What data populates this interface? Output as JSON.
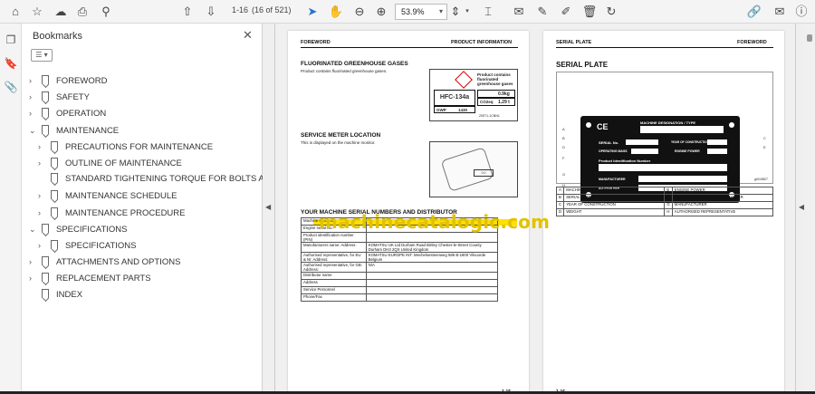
{
  "toolbar": {
    "page_current": "1-16",
    "page_count": "(16 of 521)",
    "zoom": "53.9%"
  },
  "bookmarks": {
    "title": "Bookmarks",
    "items": [
      {
        "label": "FOREWORD",
        "level": 0,
        "expand": true
      },
      {
        "label": "SAFETY",
        "level": 0,
        "expand": true
      },
      {
        "label": "OPERATION",
        "level": 0,
        "expand": true
      },
      {
        "label": "MAINTENANCE",
        "level": 0,
        "expanded": true
      },
      {
        "label": "PRECAUTIONS FOR MAINTENANCE",
        "level": 1,
        "expand": true
      },
      {
        "label": "OUTLINE OF MAINTENANCE",
        "level": 1,
        "expand": true
      },
      {
        "label": "STANDARD TIGHTENING TORQUE FOR BOLTS AND NUTS",
        "level": 1,
        "expand": false
      },
      {
        "label": "MAINTENANCE SCHEDULE",
        "level": 1,
        "expand": true
      },
      {
        "label": "MAINTENANCE PROCEDURE",
        "level": 1,
        "expand": true
      },
      {
        "label": "SPECIFICATIONS",
        "level": 0,
        "expanded": true
      },
      {
        "label": "SPECIFICATIONS",
        "level": 1,
        "expand": true
      },
      {
        "label": "ATTACHMENTS AND OPTIONS",
        "level": 0,
        "expand": true
      },
      {
        "label": "REPLACEMENT PARTS",
        "level": 0,
        "expand": true
      },
      {
        "label": "INDEX",
        "level": 0,
        "expand": false
      }
    ]
  },
  "left_page": {
    "header_left": "FOREWORD",
    "header_right": "PRODUCT INFORMATION",
    "section1_title": "FLUORINATED GREENHOUSE GASES",
    "section1_text": "Product contains fluorinated greenhouse gases.",
    "label_gas": "HFC-134a",
    "label_product": "Product contains fluorinated greenhouse gases",
    "label_weight": "0.9kg",
    "label_co2": "CO2eq",
    "label_co2_value": "1.29 t",
    "label_gwp": "GWP",
    "label_gwp_value": "1430",
    "label_code": "20S71-1CNN1",
    "section2_title": "SERVICE METER LOCATION",
    "section2_text": "This is displayed on the machine monitor.",
    "section3_title": "YOUR MACHINE SERIAL NUMBERS AND DISTRIBUTOR",
    "table": [
      [
        "Machine serial No.",
        ""
      ],
      [
        "Engine serial No.",
        ""
      ],
      [
        "Product identification number (PIN)",
        ""
      ],
      [
        "Manufacturers name: Address:",
        "KOMATSU UK Ltd Durham Road Birtley Chester-le-Street County Durham DH3 2QX United Kingdom"
      ],
      [
        "Authorised representative, for EU & NI: Address:",
        "KOMATSU EUROPE INT. Mechelsesteenweg 586 B-1800 Vilvoorde Belgium"
      ],
      [
        "Authorised representative, for GB: Address:",
        "N/A"
      ],
      [
        "Distributor name",
        ""
      ],
      [
        "Address",
        ""
      ],
      [
        "Service Personnel",
        ""
      ],
      [
        "Phone/Fax",
        ""
      ]
    ],
    "footer": "1-15"
  },
  "right_page": {
    "header_left": "SERIAL PLATE",
    "header_right": "FOREWORD",
    "title": "SERIAL PLATE",
    "plate": {
      "ce": "CE",
      "machine_designation": "MACHINE DESIGNATION / TYPE",
      "serial_no": "SERIAL No.",
      "year": "YEAR OF CONSTRUCTION",
      "operating_mass": "OPERATING MASS",
      "engine_power": "ENGINE POWER",
      "pin": "Product Identification Number",
      "manufacturer": "MANUFACTURER",
      "author_rep": "AUTHOR REP."
    },
    "figure_code": "gr019827",
    "legend": [
      [
        "A",
        "MACHINE DESIGNATION/TYPE",
        "E",
        "ENGINE POWER"
      ],
      [
        "B",
        "SERIAL NUMBER",
        "F",
        "PRODUCT IDENTIFICATION NUMBER"
      ],
      [
        "C",
        "YEAR OF CONSTRUCTION",
        "G",
        "MANUFACTURER"
      ],
      [
        "D",
        "WEIGHT",
        "H",
        "AUTHORISED REPRESENTATIVE"
      ]
    ],
    "footer": "1-16"
  },
  "watermark": "machinecatalogic.com"
}
